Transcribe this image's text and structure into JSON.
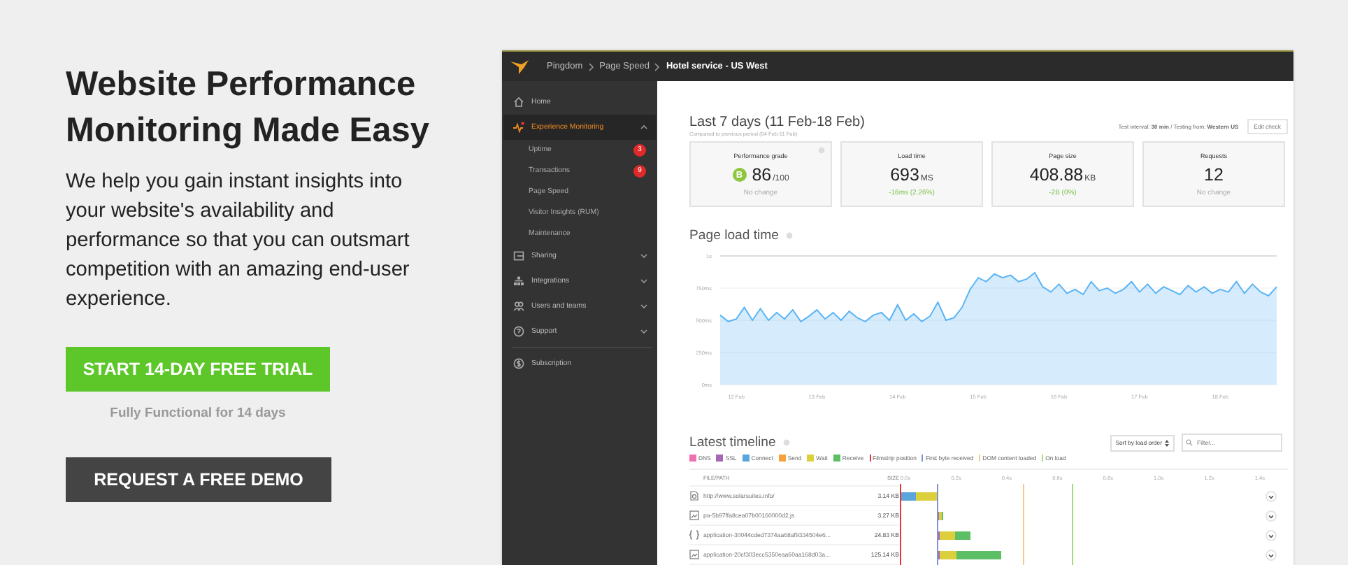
{
  "hero": {
    "title": "Website Performance Monitoring Made Easy",
    "text": "We help you gain instant insights into your website's availability and performance so that you can outsmart competition with an amazing end-user experience.",
    "trial_button": "START 14-DAY FREE TRIAL",
    "trial_note": "Fully Functional for 14 days",
    "demo_button": "REQUEST A FREE DEMO"
  },
  "app": {
    "breadcrumbs": [
      "Pingdom",
      "Page Speed",
      "Hotel service - US West"
    ],
    "sidebar": {
      "items": [
        {
          "label": "Home",
          "selected": false
        },
        {
          "label": "Experience Monitoring",
          "selected": true,
          "expanded": true,
          "children": [
            {
              "label": "Uptime",
              "badge": "3",
              "selected": false
            },
            {
              "label": "Transactions",
              "badge": "9",
              "selected": false
            },
            {
              "label": "Page Speed",
              "selected": false
            },
            {
              "label": "Visitor Insights (RUM)",
              "selected": false
            },
            {
              "label": "Maintenance",
              "selected": false
            }
          ]
        },
        {
          "label": "Sharing",
          "selected": false,
          "expanded": false
        },
        {
          "label": "Integrations",
          "selected": false,
          "expanded": false
        },
        {
          "label": "Users and teams",
          "selected": false,
          "expanded": false
        },
        {
          "label": "Support",
          "selected": false,
          "expanded": false
        },
        {
          "label": "Subscription",
          "selected": false,
          "divider_before": true
        }
      ]
    },
    "main": {
      "title": "Last 7 days (11 Feb-18 Feb)",
      "subtitle": "Compared to previous period (04 Feb-11 Feb)",
      "test_info": "Test interval: **30 min** / Testing from: **Western US**",
      "edit_button": "Edit check",
      "cards": [
        {
          "title": "Performance grade",
          "grade": "B",
          "value": "86",
          "unit": "/100",
          "change": "No change",
          "improved": false,
          "info": true
        },
        {
          "title": "Load time",
          "value": "693",
          "unit": "MS",
          "change": "-16ms (2.26%)",
          "improved": true
        },
        {
          "title": "Page size",
          "value": "408.88",
          "unit": "KB",
          "change": "-2B (0%)",
          "improved": true
        },
        {
          "title": "Requests",
          "value": "12",
          "change": "No change",
          "improved": false
        }
      ],
      "load_chart": {
        "title": "Page load time",
        "chart_data": {
          "type": "area",
          "categories": [
            null,
            null,
            "12 Feb",
            null,
            null,
            null,
            null,
            null,
            null,
            null,
            null,
            null,
            "13 Feb",
            null,
            null,
            null,
            null,
            null,
            null,
            null,
            null,
            null,
            "14 Feb",
            null,
            null,
            null,
            null,
            null,
            null,
            null,
            null,
            null,
            "15 Feb",
            null,
            null,
            null,
            null,
            null,
            null,
            null,
            null,
            null,
            "16 Feb",
            null,
            null,
            null,
            null,
            null,
            null,
            null,
            null,
            null,
            "17 Feb",
            null,
            null,
            null,
            null,
            null,
            null,
            null,
            null,
            null,
            "18 Feb",
            null,
            null,
            null,
            null,
            null,
            null,
            null
          ],
          "series": [
            {
              "color": "#5ab4f5",
              "values": [
                540,
                490,
                510,
                600,
                500,
                590,
                500,
                560,
                510,
                580,
                490,
                530,
                580,
                510,
                560,
                500,
                570,
                520,
                490,
                540,
                560,
                500,
                620,
                500,
                550,
                490,
                530,
                640,
                500,
                520,
                600,
                740,
                830,
                800,
                860,
                830,
                850,
                800,
                820,
                870,
                760,
                720,
                780,
                710,
                740,
                700,
                800,
                730,
                750,
                710,
                740,
                800,
                720,
                780,
                710,
                760,
                730,
                700,
                770,
                720,
                760,
                710,
                740,
                720,
                800,
                710,
                780,
                720,
                690,
                760
              ]
            }
          ],
          "ylim": [
            0,
            1000
          ],
          "grid": true,
          "yticks": [
            {
              "value": 0,
              "label": "0ms"
            },
            {
              "value": 250,
              "label": "250ms"
            },
            {
              "value": 500,
              "label": "500ms"
            },
            {
              "value": 750,
              "label": "750ms"
            }
          ],
          "ref_lines": [
            {
              "axis": "y",
              "value": 1000,
              "label": "1s"
            }
          ]
        }
      },
      "timeline": {
        "title": "Latest timeline",
        "sort": "Sort by load order",
        "filter_placeholder": "Filter...",
        "legend": [
          {
            "label": "DNS",
            "color": "#f06fae",
            "kind": "phase"
          },
          {
            "label": "SSL",
            "color": "#a867b5",
            "kind": "phase"
          },
          {
            "label": "Connect",
            "color": "#5aa5dc",
            "kind": "phase"
          },
          {
            "label": "Send",
            "color": "#f6a13b",
            "kind": "phase"
          },
          {
            "label": "Wait",
            "color": "#dccf3c",
            "kind": "phase"
          },
          {
            "label": "Receive",
            "color": "#5cbf66",
            "kind": "phase"
          },
          {
            "label": "Filmstrip position",
            "color": "#e8323c",
            "kind": "marker"
          },
          {
            "label": "First byte received",
            "color": "#7f93d9",
            "kind": "marker"
          },
          {
            "label": "DOM content loaded",
            "color": "#f7c98a",
            "kind": "marker"
          },
          {
            "label": "On load",
            "color": "#a6d97a",
            "kind": "marker"
          }
        ],
        "columns": [
          "FILE/PATH",
          "SIZE"
        ],
        "scale": [
          "0.0s",
          "0.2s",
          "0.4s",
          "0.6s",
          "0.8s",
          "1.0s",
          "1.2s",
          "1.4s"
        ],
        "rows": [
          {
            "name": "http://www.solarsuites.info/",
            "size": "3.14 KB"
          },
          {
            "name": "pa-5b97ffa8cea07b00160000d2.js",
            "size": "3.27 KB"
          },
          {
            "name": "application-30044cded7374aa68af9334504e6...",
            "size": "24.83 KB"
          },
          {
            "name": "application-20cf303ecc5350eaa60aa168d03a...",
            "size": "125.14 KB"
          }
        ]
      }
    }
  }
}
